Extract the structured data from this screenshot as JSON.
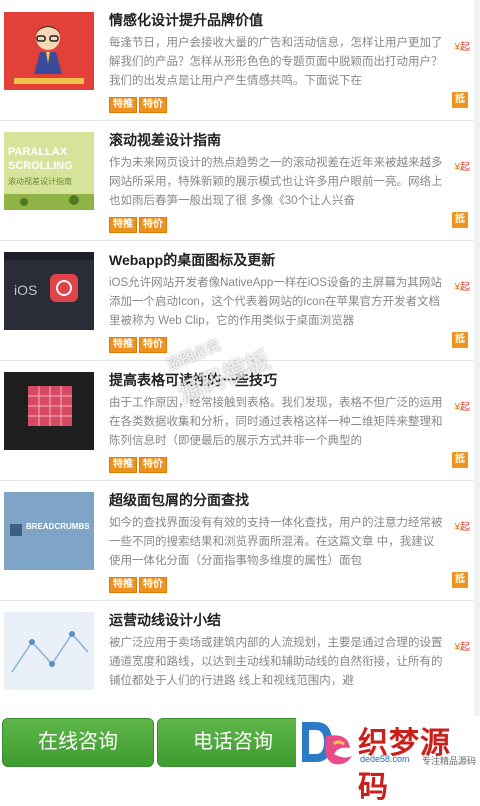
{
  "items": [
    {
      "title": "情感化设计提升品牌价值",
      "desc": "每逢节日，用户会接收大量的广告和活动信息，怎样让用户更加了解我们的产品？怎样从形形色色的专题页面中脱颖而出打动用户？我们的出发点是让用户产生情感共鸣。下面说下在",
      "thumb_icon": "character-illustration-icon"
    },
    {
      "title": "滚动视差设计指南",
      "desc": "作为未来网页设计的热点趋势之一的滚动视差在近年来被越来越多网站所采用，特殊新颖的展示模式也让许多用户眼前一亮。网络上也如雨后春笋一般出现了很 多像《30个让人兴奋",
      "thumb_text_1": "PARALLAX",
      "thumb_text_2": "SCROLLING",
      "thumb_text_3": "滚动视差设计指南"
    },
    {
      "title": "Webapp的桌面图标及更新",
      "desc": "iOS允许网站开发者像NativeApp一样在iOS设备的主屏幕为其网站添加一个启动Icon，这个代表着网站的Icon在苹果官方开发者文档里被称为 Web Clip，它的作用类似于桌面浏览器",
      "thumb_text_1": "iOS"
    },
    {
      "title": "提高表格可读性的一些技巧",
      "desc": "由于工作原因，经常接触到表格。我们发现，表格不但广泛的运用在各类数据收集和分析，同时通过表格这样一种二维矩阵来整理和陈列信息时（即便最后的展示方式并非一个典型的"
    },
    {
      "title": "超级面包屑的分面查找",
      "desc": "如今的查找界面没有有效的支持一体化查找，用户的注意力经常被一些不同的搜索结果和浏览界面所混淆。在这篇文章 中，我建议使用一体化分面（分面指事物多维度的属性）面包",
      "thumb_text_1": "BREADCRUMBS"
    },
    {
      "title": "运营动线设计小结",
      "desc": "被广泛应用于卖场或建筑内部的人流规划，主要是通过合理的设置通道宽度和路线，以达到主动线和辅助动线的自然衔接，让所有的铺位都处于人们的行进路 线上和视线范围内，避"
    }
  ],
  "tag_1": "特推",
  "tag_2": "特价",
  "price_symbol": "¥",
  "price_suffix": "起",
  "badge": "抵",
  "footer": {
    "btn_online": "在线咨询",
    "btn_phone": "电话咨询"
  },
  "logo": {
    "brand": "织梦源码",
    "site": "dede58.com",
    "slogan": "专注精品源码"
  },
  "watermark": {
    "line1": "盗图必究",
    "line2": "源码模板"
  },
  "colors": {
    "accent": "#f0921e",
    "button_green": "#4aa93a",
    "price_red": "#d43b2a"
  }
}
